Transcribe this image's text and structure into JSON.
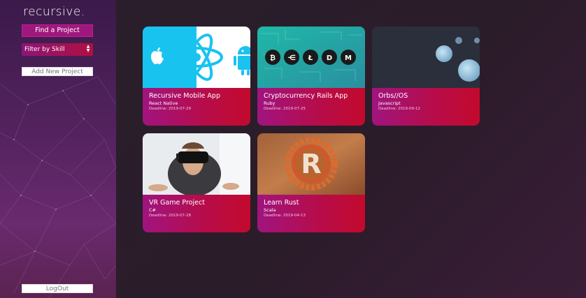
{
  "sidebar": {
    "logo": "recursive.",
    "find_project": "Find a Project",
    "filter_label": "Filter by Skill",
    "add_project": "Add New Project",
    "logout": "LogOut"
  },
  "projects": [
    {
      "title": "Recursive Mobile App",
      "language": "React Native",
      "deadline": "Deadline: 2019-07-29"
    },
    {
      "title": "Cryptocurrency Rails App",
      "language": "Ruby",
      "deadline": "Deadline: 2019-07-25"
    },
    {
      "title": "Orbs//OS",
      "language": "Javascript",
      "deadline": "Deadline: 2019-09-12"
    },
    {
      "title": "VR Game Project",
      "language": "C#",
      "deadline": "Deadline: 2019-07-28"
    },
    {
      "title": "Learn Rust",
      "language": "Scala",
      "deadline": "Deadline: 2019-04-13"
    }
  ],
  "colors": {
    "accent": "#a0177e",
    "card_gradient_end": "#c30a2d",
    "background": "#2b1c2a"
  },
  "icons": [
    "apple-icon",
    "react-icon",
    "android-icon",
    "bitcoin-icon",
    "ripple-icon",
    "litecoin-icon",
    "dash-icon",
    "monero-icon",
    "rust-logo-icon"
  ]
}
